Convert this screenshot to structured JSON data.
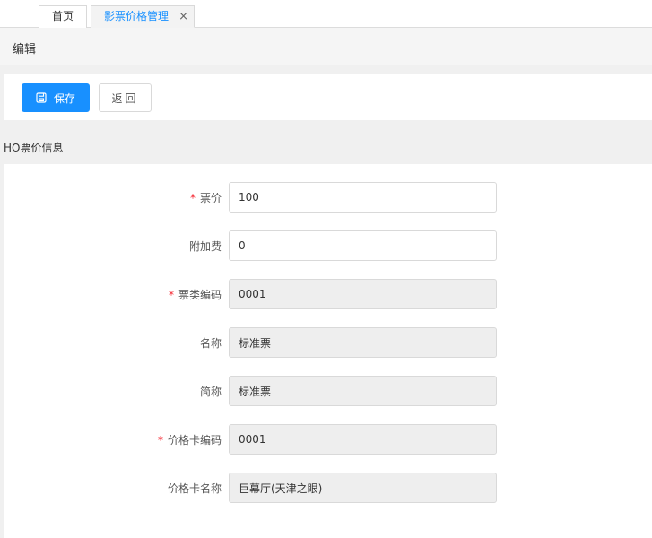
{
  "tabs": [
    {
      "label": "首页"
    },
    {
      "label": "影票价格管理",
      "close": "×"
    }
  ],
  "page": {
    "title": "编辑"
  },
  "toolbar": {
    "save_label": "保存",
    "back_label": "返回"
  },
  "section": {
    "title": "HO票价信息"
  },
  "form": {
    "fields": [
      {
        "label": "票价",
        "required": "*",
        "value": "100"
      },
      {
        "label": "附加费",
        "value": "0"
      },
      {
        "label": "票类编码",
        "required": "*",
        "value": "0001"
      },
      {
        "label": "名称",
        "value": "标准票"
      },
      {
        "label": "简称",
        "value": "标准票"
      },
      {
        "label": "价格卡编码",
        "required": "*",
        "value": "0001"
      },
      {
        "label": "价格卡名称",
        "value": "巨幕厅(天津之眼)"
      }
    ]
  },
  "colors": {
    "accent": "#1890ff",
    "required": "#f5222d"
  }
}
